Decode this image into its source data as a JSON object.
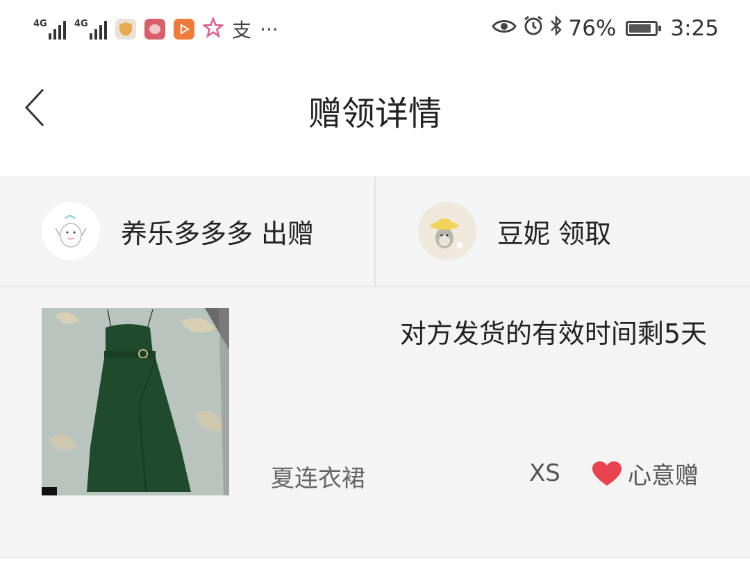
{
  "status_bar": {
    "network_1": "4G",
    "network_2": "4G",
    "extra_app_glyph": "支",
    "more_glyph": "···",
    "battery": "76%",
    "time": "3:25",
    "icons": [
      "signal-icon",
      "shield-app-icon",
      "weibo-app-icon",
      "video-app-icon",
      "star-icon",
      "eye-icon",
      "alarm-icon",
      "bluetooth-icon",
      "battery-icon"
    ]
  },
  "nav": {
    "title": "赠领详情"
  },
  "giver": {
    "name": "养乐多多多",
    "role": "出赠"
  },
  "receiver": {
    "name": "豆妮",
    "role": "领取"
  },
  "item": {
    "countdown": "对方发货的有效时间剩5天",
    "name": "夏连衣裙",
    "size": "XS",
    "gift_type": "心意赠"
  },
  "colors": {
    "heart": "#e8434f",
    "card_bg": "#f4f4f4",
    "dress": "#1f4a2c"
  }
}
